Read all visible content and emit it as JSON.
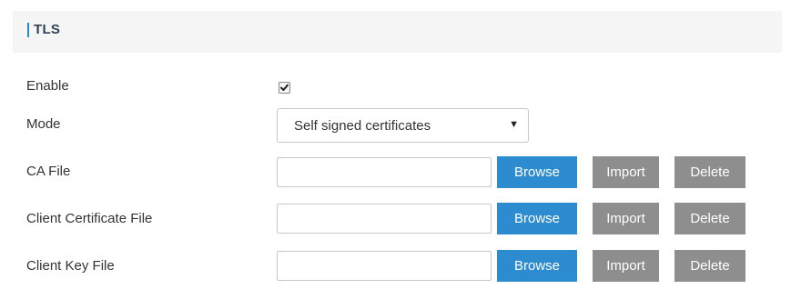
{
  "section": {
    "title": "TLS"
  },
  "enable": {
    "label": "Enable",
    "checked": true
  },
  "mode": {
    "label": "Mode",
    "selected": "Self signed certificates"
  },
  "ca_file": {
    "label": "CA File",
    "value": ""
  },
  "client_cert": {
    "label": "Client Certificate File",
    "value": ""
  },
  "client_key": {
    "label": "Client Key File",
    "value": ""
  },
  "buttons": {
    "browse": "Browse",
    "import": "Import",
    "delete": "Delete"
  },
  "icons": {
    "select_arrow": "▼",
    "checkbox_icon": "check-icon"
  },
  "colors": {
    "accent": "#2d8ccf",
    "secondary_button": "#8e8e8e",
    "section_bar": "#2f86c8"
  }
}
